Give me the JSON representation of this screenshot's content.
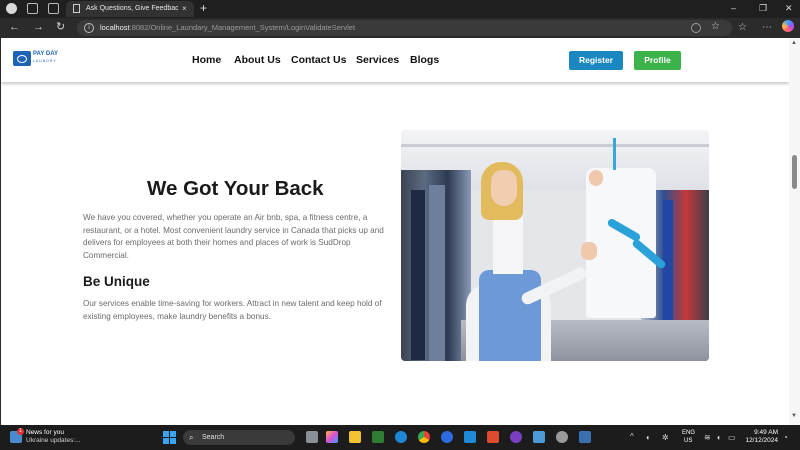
{
  "browser": {
    "tab_title": "Ask Questions, Give Feedback, an",
    "tab_close": "×",
    "new_tab": "+",
    "url_host": "localhost",
    "url_path": ":8082/Online_Laundary_Management_System/LoginValidateServlet",
    "window_controls": [
      "–",
      "❐",
      "✕"
    ]
  },
  "site": {
    "logo_text": "PAY DAY",
    "logo_subtext": "LAUNDRY",
    "nav": [
      "Home",
      "About Us",
      "Contact Us",
      "Services",
      "Blogs"
    ],
    "register_label": "Register",
    "profile_label": "Profile"
  },
  "content": {
    "heading": "We Got Your Back",
    "paragraph1": "We have you covered, whether you operate an Air bnb, spa, a fitness centre, a restaurant, or a hotel. Most convenient laundry service in Canada that picks up and delivers for employees at both their homes and places of work is SudDrop Commercial.",
    "subheading": "Be Unique",
    "paragraph2": "Our services enable time-saving for workers. Attract in new talent and keep hold of existing employees, make laundry benefits a bonus."
  },
  "taskbar": {
    "news_title": "News for you",
    "news_subtitle": "Ukraine updates:...",
    "news_badge": "1",
    "search_label": "Search",
    "lang_line1": "ENG",
    "lang_line2": "US",
    "time": "9:49 AM",
    "date": "12/12/2024"
  },
  "colors": {
    "register": "#1b87c1",
    "profile": "#3cb24a",
    "logo": "#1e63b5"
  }
}
